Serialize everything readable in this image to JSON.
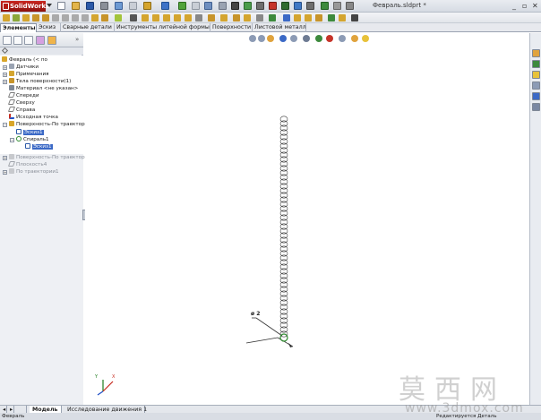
{
  "app": {
    "logo_text": "SolidWorks",
    "window_title": "Февраль.sldprt *"
  },
  "feature_tabs": [
    "Элементы",
    "Эскиз",
    "Сварные детали",
    "Инструменты литейной формы",
    "Поверхности",
    "Листовой металл"
  ],
  "feature_tree": {
    "root": "Февраль  (< по",
    "items": [
      {
        "label": "Датчики",
        "icon": "sensor-icon"
      },
      {
        "label": "Примечания",
        "icon": "annotations-icon"
      },
      {
        "label": "Тела поверхности(1)",
        "icon": "surface-bodies-icon"
      },
      {
        "label": "Материал <не указан>",
        "icon": "material-icon"
      },
      {
        "label": "Спереди",
        "icon": "plane-icon"
      },
      {
        "label": "Сверху",
        "icon": "plane-icon"
      },
      {
        "label": "Справа",
        "icon": "plane-icon"
      },
      {
        "label": "Исходная точка",
        "icon": "origin-icon"
      },
      {
        "label": "Поверхность-По траектори",
        "icon": "sweep-surface-icon"
      }
    ],
    "sweep_children": [
      {
        "label": "Эскиз1",
        "icon": "sketch-icon",
        "selected": true
      },
      {
        "label": "Спираль1",
        "icon": "helix-icon"
      },
      {
        "label": "Эскиз1",
        "icon": "sketch-icon",
        "selected": true
      }
    ],
    "rolled_back": [
      {
        "label": "Поверхность-По траектори",
        "icon": "sweep-surface-icon"
      },
      {
        "label": "Плоскость4",
        "icon": "plane-icon"
      },
      {
        "label": "По траектории1",
        "icon": "sweep-icon"
      }
    ]
  },
  "graphics": {
    "dimension_label": "ø 2",
    "triad_axes": [
      "Y",
      "X"
    ]
  },
  "bottom_tabs": [
    "Модель",
    "Исследование движения 1"
  ],
  "status": {
    "left": "Февраль",
    "right": "Редактируется Деталь"
  },
  "watermark": {
    "chars": "莫西网",
    "url": "www.3dmox.com"
  }
}
